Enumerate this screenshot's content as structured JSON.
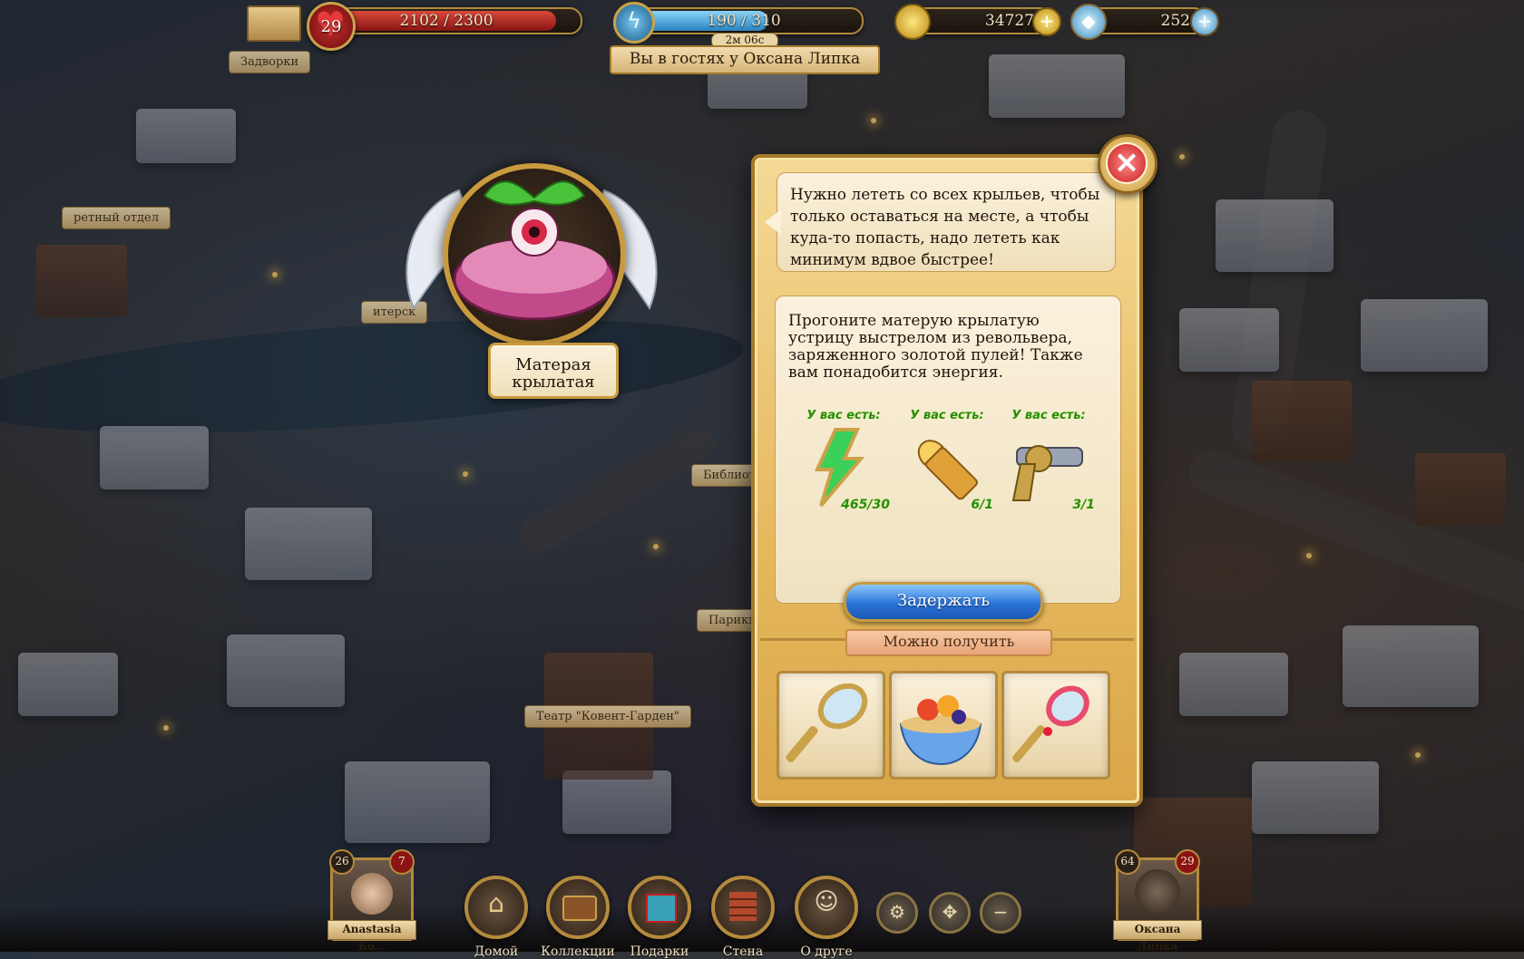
{
  "hud": {
    "level": "29",
    "hp_text": "2102 / 2300",
    "hp_fraction": 0.914,
    "energy_text": "190 / 310",
    "energy_fraction": 0.613,
    "energy_timer": "2м 06с",
    "visit_text": "Вы в гостях у Оксана Липка",
    "coins": "34727",
    "gems": "252"
  },
  "map_labels": [
    "Задворки",
    "ретный отдел",
    "итерск",
    "Библиот",
    "Парикм",
    "Театр \"Ковент-Гарден\""
  ],
  "monster": {
    "name_line1": "Матерая",
    "name_line2": "крылатая"
  },
  "dialog": {
    "speech": "Нужно лететь со всех крыльев, чтобы только оставаться на месте, а чтобы куда-то попасть, надо лететь как минимум вдвое быстрее!",
    "task": "Прогоните матерую крылатую устрицу выстрелом из револьвера, заряженного золотой пулей! Также вам понадобится энергия.",
    "requirements": [
      {
        "header": "У вас есть:",
        "icon": "energy-bolt-icon",
        "count": "465/30"
      },
      {
        "header": "У вас есть:",
        "icon": "golden-bullet-icon",
        "count": "6/1"
      },
      {
        "header": "У вас есть:",
        "icon": "revolver-icon",
        "count": "3/1"
      }
    ],
    "hold_button": "Задержать",
    "reward_label": "Можно получить",
    "rewards": [
      "golden-hand-mirror-icon",
      "fruit-bowl-icon",
      "jeweled-hand-mirror-icon"
    ]
  },
  "bottom_nav": {
    "home": "Домой",
    "collections": "Коллекции",
    "gifts": "Подарки",
    "wall": "Стена",
    "about_friend": "О друге"
  },
  "friends": {
    "left": {
      "name": "Anastasia Ko...",
      "level": "26",
      "hearts": "7"
    },
    "right": {
      "name": "Оксана Липка",
      "level": "64",
      "hearts": "29"
    }
  },
  "colors": {
    "accent_gold": "#c99a3e",
    "hp_red": "#b41e1e",
    "energy_blue": "#4aa4d8",
    "button_blue": "#2a74d8",
    "close_red": "#c81c1c"
  }
}
